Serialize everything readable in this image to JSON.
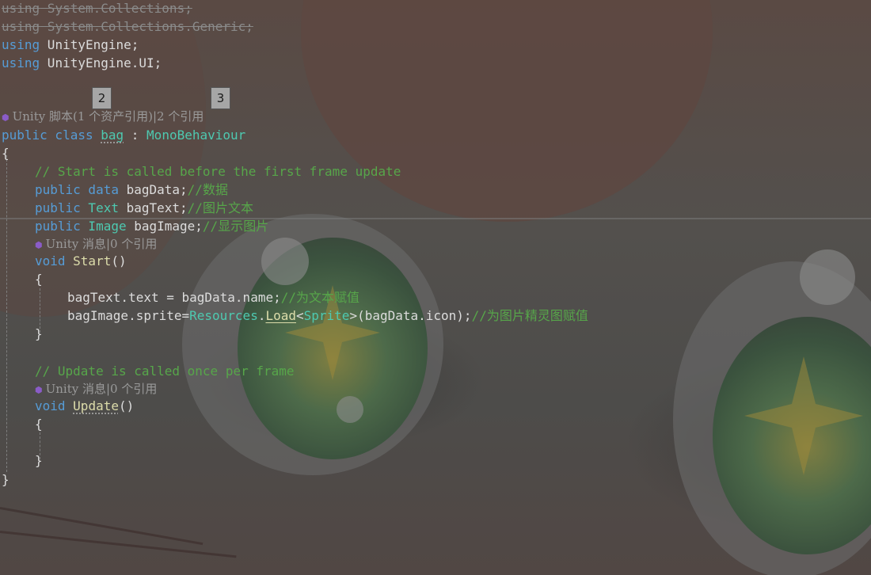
{
  "code": {
    "line_using_collections": [
      "using",
      " System.Collections;"
    ],
    "line_using_generic": [
      "using",
      " System.Collections.Generic;"
    ],
    "line_using_unity": [
      "using",
      " UnityEngine;"
    ],
    "line_using_ui": [
      "using",
      " UnityEngine.UI;"
    ],
    "codelens_class": "Unity 脚本(1 个资产引用)|2 个引用",
    "class_decl": {
      "public": "public",
      "class": " class ",
      "name": "bag",
      "sep": " : ",
      "base": "MonoBehaviour"
    },
    "brace_open": "{",
    "comment_start": "// Start is called before the first frame update",
    "field_data": {
      "public": "public",
      "type": " data",
      "rest": " bagData;",
      "comment": "//数据"
    },
    "field_text": {
      "public": "public",
      "type": " Text",
      "rest": " bagText;",
      "comment": "//图片文本"
    },
    "field_image": {
      "public": "public",
      "type": " Image",
      "rest": " bagImage;",
      "comment": "//显示图片"
    },
    "codelens_start": "Unity 消息|0 个引用",
    "start_decl": {
      "void": "void",
      "name": " Start",
      "parens": "()"
    },
    "inner_brace_open": "{",
    "stmt_text": {
      "code": "bagText.text = bagData.name;",
      "comment": "//为文本赋值"
    },
    "stmt_sprite": {
      "a": "bagImage.sprite=",
      "resources": "Resources",
      "dot": ".",
      "load": "Load",
      "lt": "<",
      "sprite": "Sprite",
      "rest": ">(bagData.icon);",
      "comment": "//为图片精灵图赋值"
    },
    "inner_brace_close": "}",
    "comment_update": "// Update is called once per frame",
    "codelens_update": "Unity 消息|0 个引用",
    "update_decl": {
      "void": "void",
      "name": "Update",
      "parens": "()"
    },
    "brace_close": "}"
  },
  "tooltips": {
    "first": "2",
    "second": "3"
  },
  "colors": {
    "keyword": "#569cd6",
    "type": "#4ec9b0",
    "comment": "#57a64a",
    "function": "#dcdcaa",
    "text": "#dcdcdc",
    "codelens": "#9a9a9a"
  }
}
